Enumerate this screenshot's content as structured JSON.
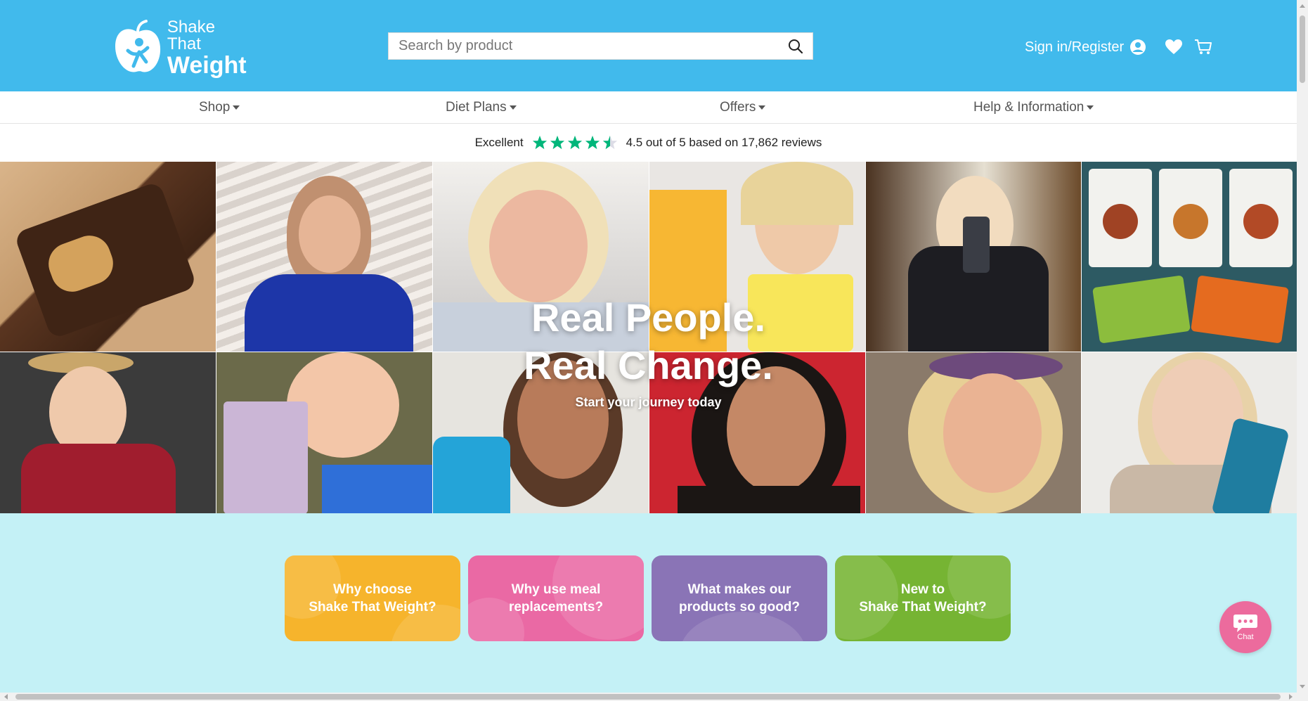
{
  "header": {
    "logo_line1": "Shake That",
    "logo_line2": "Weight",
    "search_placeholder": "Search by product",
    "signin_label": "Sign in/Register",
    "icons": {
      "search": "search-icon",
      "user": "user-circle-icon",
      "wishlist": "heart-icon",
      "cart": "cart-icon"
    },
    "bg_color": "#41baec"
  },
  "nav": {
    "items": [
      {
        "label": "Shop"
      },
      {
        "label": "Diet Plans"
      },
      {
        "label": "Offers"
      },
      {
        "label": "Help & Information"
      }
    ]
  },
  "trustpilot": {
    "rating_word": "Excellent",
    "stars": 4.5,
    "summary": "4.5 out of 5 based on 17,862 reviews",
    "star_color": "#00b67a"
  },
  "hero": {
    "title_line1": "Real People.",
    "title_line2": "Real Change.",
    "subtitle": "Start your journey today",
    "tiles": [
      "chocolate bar",
      "woman in blue dress",
      "smiling blonde woman",
      "woman holding shake box",
      "woman mirror selfie",
      "meal pouches",
      "woman in sun hat",
      "woman holding shake pack",
      "woman with shaker bottle",
      "smiling woman selfie",
      "woman with headband",
      "woman with shaker"
    ]
  },
  "cards": [
    {
      "label": "Why choose\nShake That Weight?",
      "color": "#f6b42c"
    },
    {
      "label": "Why use meal\nreplacements?",
      "color": "#ea69a4"
    },
    {
      "label": "What makes our\nproducts so good?",
      "color": "#8a74b6"
    },
    {
      "label": "New to\nShake That Weight?",
      "color": "#76b433"
    }
  ],
  "cards_bg": "#c4f1f6",
  "chat": {
    "label": "Chat",
    "color": "#ec6b9d"
  }
}
